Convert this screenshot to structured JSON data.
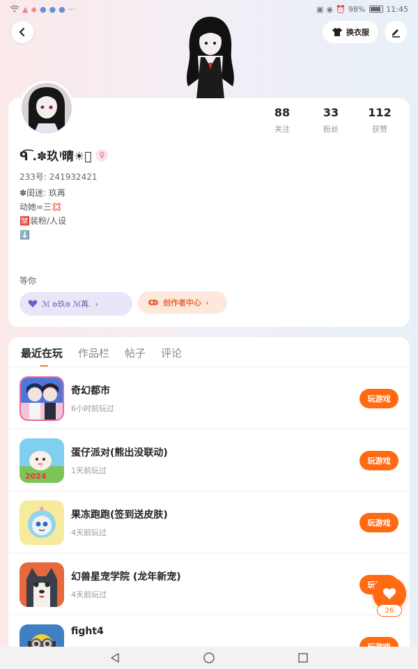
{
  "status_bar": {
    "time": "11:45",
    "battery": "98%"
  },
  "top_bar": {
    "dress_label": "换衣服"
  },
  "profile": {
    "nickname": "ᑫ͡ .✽玖 ͪ晴☀ͥ",
    "uid": "233号: 241932421",
    "bio": [
      "✽闺迷: 玖苒",
      "动她=三💢",
      "🈲装粉/人设",
      "⬇️"
    ],
    "wait_text": "等你",
    "stats": [
      {
        "value": "88",
        "label": "关注"
      },
      {
        "value": "33",
        "label": "粉丝"
      },
      {
        "value": "112",
        "label": "获赞"
      }
    ],
    "club_label": "ℳ ʚ玖ɞ ℳ苒.",
    "creator_label": "创作者中心"
  },
  "tabs": [
    "最近在玩",
    "作品栏",
    "帖子",
    "评论"
  ],
  "games": [
    {
      "title": "奇幻都市",
      "time": "6小时前玩过",
      "button": "玩游戏"
    },
    {
      "title": "蛋仔派对(熊出没联动)",
      "time": "1天前玩过",
      "button": "玩游戏"
    },
    {
      "title": "果冻跑跑(签到送皮肤)",
      "time": "4天前玩过",
      "button": "玩游戏"
    },
    {
      "title": "幻兽星宠学院 (龙年新宠)",
      "time": "4天前玩过",
      "button": "玩游戏"
    },
    {
      "title": "fight4",
      "time": "",
      "button": "玩游戏"
    }
  ],
  "like": {
    "count": "26"
  },
  "colors": {
    "accent": "#ff6a13",
    "club": "#5a55b0",
    "creator": "#e8683a"
  }
}
